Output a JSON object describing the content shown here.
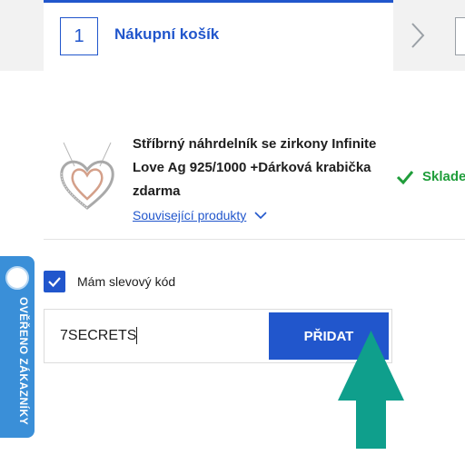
{
  "header": {
    "step_number": "1",
    "step_label": "Nákupní košík"
  },
  "product": {
    "title": "Stříbrný náhrdelník se zirkony Infinite Love Ag 925/1000 +Dárková krabička zdarma",
    "related_link": "Související produkty",
    "stock_status": "Skladem"
  },
  "badge": {
    "text": "OVĚŘENO ZÁKAZNÍKY"
  },
  "coupon": {
    "checkbox_label": "Mám slevový kód",
    "checked": true,
    "input_value": "7SECRETS",
    "add_button_label": "PŘIDAT"
  },
  "colors": {
    "brand_blue": "#2156cc",
    "stock_green": "#1f9d3a",
    "badge_blue": "#3a8fd8",
    "arrow_teal": "#0f9f8c"
  },
  "icons": [
    "chevron-right-icon",
    "chevron-down-icon",
    "checkmark-icon",
    "checkbox-checked-icon",
    "badge-seal-icon",
    "arrow-up-icon"
  ]
}
